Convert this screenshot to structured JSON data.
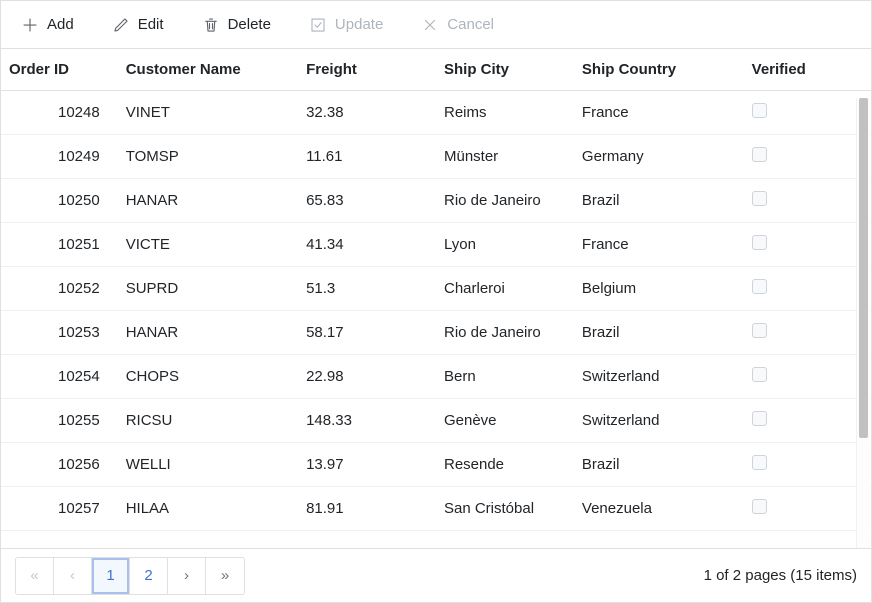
{
  "toolbar": {
    "add": "Add",
    "edit": "Edit",
    "delete": "Delete",
    "update": "Update",
    "cancel": "Cancel"
  },
  "columns": {
    "orderId": "Order ID",
    "customer": "Customer Name",
    "freight": "Freight",
    "city": "Ship City",
    "country": "Ship Country",
    "verified": "Verified"
  },
  "rows": [
    {
      "orderId": "10248",
      "customer": "VINET",
      "freight": "32.38",
      "city": "Reims",
      "country": "France",
      "verified": false
    },
    {
      "orderId": "10249",
      "customer": "TOMSP",
      "freight": "11.61",
      "city": "Münster",
      "country": "Germany",
      "verified": false
    },
    {
      "orderId": "10250",
      "customer": "HANAR",
      "freight": "65.83",
      "city": "Rio de Janeiro",
      "country": "Brazil",
      "verified": false
    },
    {
      "orderId": "10251",
      "customer": "VICTE",
      "freight": "41.34",
      "city": "Lyon",
      "country": "France",
      "verified": false
    },
    {
      "orderId": "10252",
      "customer": "SUPRD",
      "freight": "51.3",
      "city": "Charleroi",
      "country": "Belgium",
      "verified": false
    },
    {
      "orderId": "10253",
      "customer": "HANAR",
      "freight": "58.17",
      "city": "Rio de Janeiro",
      "country": "Brazil",
      "verified": false
    },
    {
      "orderId": "10254",
      "customer": "CHOPS",
      "freight": "22.98",
      "city": "Bern",
      "country": "Switzerland",
      "verified": false
    },
    {
      "orderId": "10255",
      "customer": "RICSU",
      "freight": "148.33",
      "city": "Genève",
      "country": "Switzerland",
      "verified": false
    },
    {
      "orderId": "10256",
      "customer": "WELLI",
      "freight": "13.97",
      "city": "Resende",
      "country": "Brazil",
      "verified": false
    },
    {
      "orderId": "10257",
      "customer": "HILAA",
      "freight": "81.91",
      "city": "San Cristóbal",
      "country": "Venezuela",
      "verified": false
    }
  ],
  "pager": {
    "first": "«",
    "prev": "‹",
    "next": "›",
    "last": "»",
    "pages": [
      "1",
      "2"
    ],
    "info": "1 of 2 pages (15 items)"
  }
}
